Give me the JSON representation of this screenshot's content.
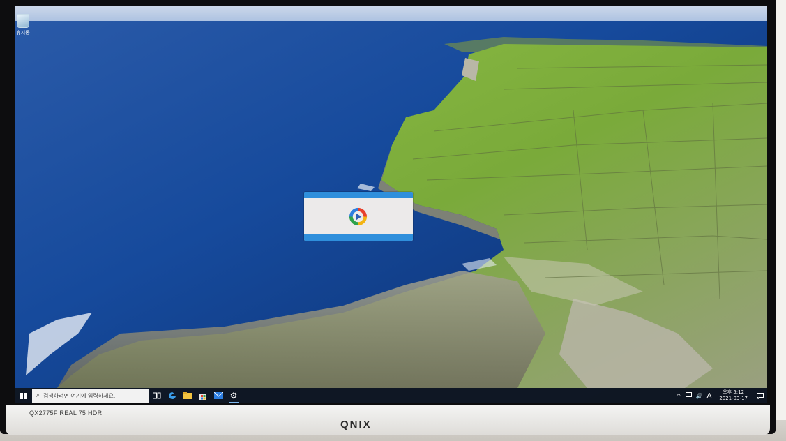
{
  "desktop": {
    "icons": [
      {
        "label": "휴지통",
        "icon": "recycle-bin-icon"
      }
    ]
  },
  "splash": {
    "logo": "app-logo-icon"
  },
  "taskbar": {
    "search_placeholder": "검색하려면 여기에 입력하세요.",
    "apps": [
      "task-view-icon",
      "edge-icon",
      "file-explorer-icon",
      "store-icon",
      "mail-icon",
      "settings-icon"
    ],
    "tray": {
      "chevron": "^",
      "volume": "🔊",
      "ime": "A"
    },
    "clock": {
      "time": "오후 5:12",
      "date": "2021-03-17"
    }
  },
  "monitor": {
    "model": "QX2775F REAL 75 HDR",
    "brand": "QNIX"
  },
  "colors": {
    "accent": "#2f8fdc",
    "taskbar": "#10161f",
    "sea": "#0d2f6e",
    "land": "#7fb23a"
  }
}
